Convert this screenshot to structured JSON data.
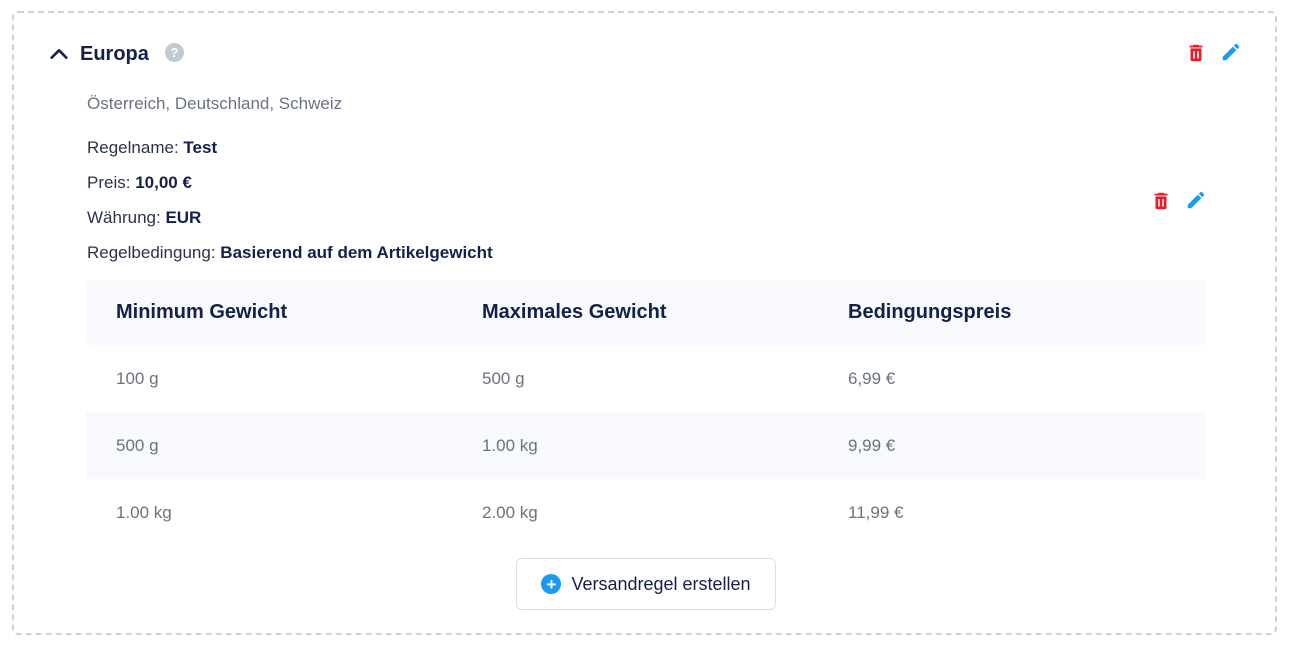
{
  "zone": {
    "title": "Europa",
    "help_symbol": "?",
    "countries": "Österreich, Deutschland, Schweiz"
  },
  "rule": {
    "name_label": "Regelname:",
    "name_value": "Test",
    "price_label": "Preis:",
    "price_value": "10,00 €",
    "currency_label": "Währung:",
    "currency_value": "EUR",
    "condition_label": "Regelbedingung:",
    "condition_value": "Basierend auf dem Artikelgewicht"
  },
  "table": {
    "headers": [
      "Minimum Gewicht",
      "Maximales Gewicht",
      "Bedingungspreis"
    ],
    "rows": [
      [
        "100 g",
        "500 g",
        "6,99 €"
      ],
      [
        "500 g",
        "1.00 kg",
        "9,99 €"
      ],
      [
        "1.00 kg",
        "2.00 kg",
        "11,99 €"
      ]
    ]
  },
  "actions": {
    "create_rule_label": "Versandregel erstellen",
    "create_icon": "+"
  },
  "icons": {
    "collapse": "chevron-up-icon",
    "delete": "trash-icon",
    "edit": "pencil-icon",
    "help": "help-icon",
    "add": "plus-circle-icon"
  },
  "colors": {
    "delete": "#e0212a",
    "edit": "#1a9af0",
    "title": "#13204a",
    "muted": "#6b7280",
    "table_stripe": "#f7f9fc"
  }
}
